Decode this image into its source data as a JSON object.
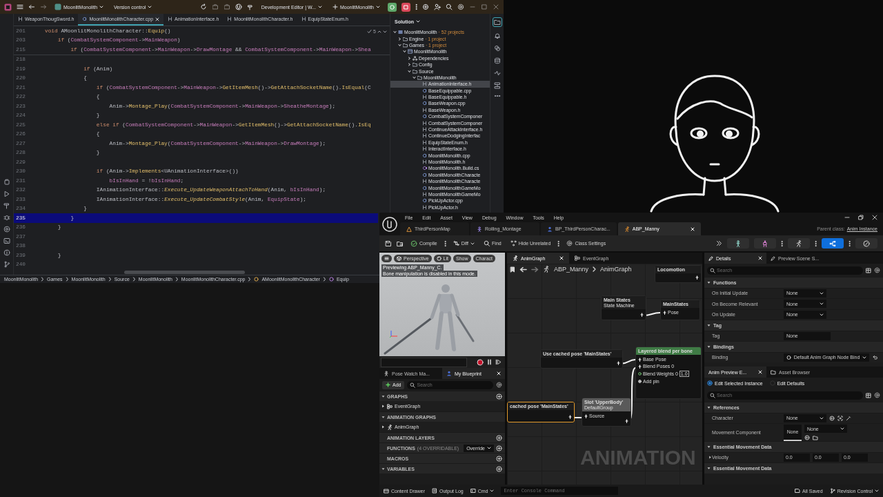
{
  "ide": {
    "title_bar": {
      "project": "MoonlitMonolith",
      "vcs": "Version control",
      "run_config": "Development Editor | W...",
      "target": "MoonlitMonolith"
    },
    "tabs": [
      {
        "label": "WeaponThougSword.h",
        "kind": "h",
        "selected": false
      },
      {
        "label": "MoonlitMonolithCharacter.cpp",
        "kind": "cpp",
        "selected": true
      },
      {
        "label": "AnimationInterface.h",
        "kind": "h",
        "selected": false
      },
      {
        "label": "MoonlitMonolithCharacter.h",
        "kind": "h",
        "selected": false
      },
      {
        "label": "EquipStateEnum.h",
        "kind": "h",
        "selected": false
      }
    ],
    "inspection_count": "5",
    "sticky_lines": [
      {
        "number": "201",
        "tokens": [
          {
            "text": "void",
            "kind": "keyword"
          },
          {
            "text": " AMoonlitMonolithCharacter::",
            "kind": "plain"
          },
          {
            "text": "Equip",
            "kind": "method"
          },
          {
            "text": "()",
            "kind": "plain"
          }
        ]
      },
      {
        "number": "203",
        "tokens": [
          {
            "text": "    if",
            "kind": "keyword"
          },
          {
            "text": " (",
            "kind": "plain"
          },
          {
            "text": "CombatSystemComponent",
            "kind": "field"
          },
          {
            "text": "->",
            "kind": "plain"
          },
          {
            "text": "MainWeapon",
            "kind": "field"
          },
          {
            "text": ")",
            "kind": "plain"
          }
        ]
      },
      {
        "number": "215",
        "tokens": [
          {
            "text": "        if",
            "kind": "keyword"
          },
          {
            "text": " (",
            "kind": "plain"
          },
          {
            "text": "CombatSystemComponent",
            "kind": "field"
          },
          {
            "text": "->",
            "kind": "plain"
          },
          {
            "text": "MainWeapon",
            "kind": "field"
          },
          {
            "text": "->",
            "kind": "plain"
          },
          {
            "text": "DrawMontage",
            "kind": "field"
          },
          {
            "text": " && ",
            "kind": "plain"
          },
          {
            "text": "CombatSystemComponent",
            "kind": "field"
          },
          {
            "text": "->",
            "kind": "plain"
          },
          {
            "text": "MainWeapon",
            "kind": "field"
          },
          {
            "text": "->",
            "kind": "plain"
          },
          {
            "text": "Shea",
            "kind": "field"
          }
        ]
      }
    ],
    "lines": [
      {
        "number": "218",
        "current": false
      },
      {
        "number": "219",
        "current": false,
        "tokens": [
          {
            "text": "            if",
            "kind": "keyword"
          },
          {
            "text": " (Anim)",
            "kind": "plain"
          }
        ]
      },
      {
        "number": "220",
        "current": false,
        "tokens": [
          {
            "text": "            {",
            "kind": "plain"
          }
        ]
      },
      {
        "number": "221",
        "current": false,
        "tokens": [
          {
            "text": "                if",
            "kind": "keyword"
          },
          {
            "text": " (",
            "kind": "plain"
          },
          {
            "text": "CombatSystemComponent",
            "kind": "field"
          },
          {
            "text": "->",
            "kind": "plain"
          },
          {
            "text": "MainWeapon",
            "kind": "field"
          },
          {
            "text": "->",
            "kind": "plain"
          },
          {
            "text": "GetItemMesh",
            "kind": "method"
          },
          {
            "text": "()->",
            "kind": "plain"
          },
          {
            "text": "GetAttachSocketName",
            "kind": "method"
          },
          {
            "text": "().",
            "kind": "plain"
          },
          {
            "text": "IsEqual",
            "kind": "method"
          },
          {
            "text": "(C",
            "kind": "plain"
          }
        ]
      },
      {
        "number": "222",
        "current": false,
        "tokens": [
          {
            "text": "                {",
            "kind": "plain"
          }
        ]
      },
      {
        "number": "223",
        "current": false,
        "tokens": [
          {
            "text": "                    Anim->",
            "kind": "plain"
          },
          {
            "text": "Montage_Play",
            "kind": "method"
          },
          {
            "text": "(",
            "kind": "plain"
          },
          {
            "text": "CombatSystemComponent",
            "kind": "field"
          },
          {
            "text": "->",
            "kind": "plain"
          },
          {
            "text": "MainWeapon",
            "kind": "field"
          },
          {
            "text": "->",
            "kind": "plain"
          },
          {
            "text": "SheatheMontage",
            "kind": "field"
          },
          {
            "text": ");",
            "kind": "plain"
          }
        ]
      },
      {
        "number": "224",
        "current": false,
        "tokens": [
          {
            "text": "                }",
            "kind": "plain"
          }
        ]
      },
      {
        "number": "225",
        "current": false,
        "tokens": [
          {
            "text": "                else if",
            "kind": "keyword"
          },
          {
            "text": " (",
            "kind": "plain"
          },
          {
            "text": "CombatSystemComponent",
            "kind": "field"
          },
          {
            "text": "->",
            "kind": "plain"
          },
          {
            "text": "MainWeapon",
            "kind": "field"
          },
          {
            "text": "->",
            "kind": "plain"
          },
          {
            "text": "GetItemMesh",
            "kind": "method"
          },
          {
            "text": "()->",
            "kind": "plain"
          },
          {
            "text": "GetAttachSocketName",
            "kind": "method"
          },
          {
            "text": "().",
            "kind": "plain"
          },
          {
            "text": "IsEq",
            "kind": "method"
          }
        ]
      },
      {
        "number": "226",
        "current": false,
        "tokens": [
          {
            "text": "                {",
            "kind": "plain"
          }
        ]
      },
      {
        "number": "227",
        "current": false,
        "tokens": [
          {
            "text": "                    Anim->",
            "kind": "plain"
          },
          {
            "text": "Montage_Play",
            "kind": "method"
          },
          {
            "text": "(",
            "kind": "plain"
          },
          {
            "text": "CombatSystemComponent",
            "kind": "field"
          },
          {
            "text": "->",
            "kind": "plain"
          },
          {
            "text": "MainWeapon",
            "kind": "field"
          },
          {
            "text": "->",
            "kind": "plain"
          },
          {
            "text": "DrawMontage",
            "kind": "field"
          },
          {
            "text": ");",
            "kind": "plain"
          }
        ]
      },
      {
        "number": "228",
        "current": false,
        "tokens": [
          {
            "text": "                }",
            "kind": "plain"
          }
        ]
      },
      {
        "number": "229",
        "current": false
      },
      {
        "number": "230",
        "current": false,
        "tokens": [
          {
            "text": "                if",
            "kind": "keyword"
          },
          {
            "text": " (Anim->",
            "kind": "plain"
          },
          {
            "text": "Implements",
            "kind": "method"
          },
          {
            "text": "<UAnimationInterface>())",
            "kind": "plain"
          }
        ]
      },
      {
        "number": "231",
        "current": false,
        "tokens": [
          {
            "text": "                    bIsInHand",
            "kind": "field"
          },
          {
            "text": " = !",
            "kind": "plain"
          },
          {
            "text": "bIsInHand",
            "kind": "field"
          },
          {
            "text": ";",
            "kind": "plain"
          }
        ]
      },
      {
        "number": "232",
        "current": false,
        "tokens": [
          {
            "text": "                IAnimationInterface::",
            "kind": "plain"
          },
          {
            "text": "Execute_UpdateWeaponAttachToHand",
            "kind": "static-method"
          },
          {
            "text": "(Anim, ",
            "kind": "plain"
          },
          {
            "text": "bIsInHand",
            "kind": "field"
          },
          {
            "text": ");",
            "kind": "plain"
          }
        ]
      },
      {
        "number": "233",
        "current": false,
        "tokens": [
          {
            "text": "                IAnimationInterface::",
            "kind": "plain"
          },
          {
            "text": "Execute_UpdateCombatStyle",
            "kind": "static-method"
          },
          {
            "text": "(Anim, ",
            "kind": "plain"
          },
          {
            "text": "EquipState",
            "kind": "field"
          },
          {
            "text": ");",
            "kind": "plain"
          }
        ]
      },
      {
        "number": "234",
        "current": false,
        "tokens": [
          {
            "text": "            }",
            "kind": "plain"
          }
        ]
      },
      {
        "number": "235",
        "current": true,
        "tokens": [
          {
            "text": "        }",
            "kind": "plain"
          }
        ]
      },
      {
        "number": "236",
        "current": false,
        "tokens": [
          {
            "text": "    }",
            "kind": "plain"
          }
        ]
      },
      {
        "number": "237",
        "current": false
      },
      {
        "number": "238",
        "current": false
      },
      {
        "number": "239",
        "current": false,
        "tokens": [
          {
            "text": "    }",
            "kind": "plain"
          }
        ]
      },
      {
        "number": "240",
        "current": false
      }
    ],
    "breadcrumb": [
      {
        "label": "MoonlitMonolith",
        "kind": "folder"
      },
      {
        "label": "Games",
        "kind": "folder"
      },
      {
        "label": "MoonlitMonolith",
        "kind": "folder"
      },
      {
        "label": "Source",
        "kind": "folder"
      },
      {
        "label": "MoonlitMonolith",
        "kind": "folder"
      },
      {
        "label": "MoonlitMonolithCharacter.cpp",
        "kind": "file"
      },
      {
        "label": "AMoonlitMonolithCharacter",
        "kind": "class"
      },
      {
        "label": "Equip",
        "kind": "method"
      }
    ],
    "solution": {
      "title": "Solution",
      "tree": [
        {
          "label": "MoonlitMonolith",
          "note": "· 52 projects",
          "kind": "solution",
          "expanded": true,
          "selected": false,
          "children": [
            {
              "label": "Engine",
              "note": "· 1 project",
              "kind": "folder",
              "expanded": false,
              "selected": false
            },
            {
              "label": "Games",
              "note": "· 1 project",
              "kind": "folder",
              "expanded": true,
              "selected": false,
              "children": [
                {
                  "label": "MoonlitMonolith",
                  "kind": "project",
                  "expanded": true,
                  "selected": false,
                  "children": [
                    {
                      "label": "Dependencies",
                      "kind": "dependencies",
                      "expanded": false,
                      "selected": false
                    },
                    {
                      "label": "Config",
                      "kind": "folder",
                      "expanded": false,
                      "selected": false
                    },
                    {
                      "label": "Source",
                      "kind": "folder",
                      "expanded": true,
                      "selected": false,
                      "children": [
                        {
                          "label": "MoonlitMonolith",
                          "kind": "folder",
                          "expanded": true,
                          "selected": false,
                          "children": [
                            {
                              "label": "AnimationInterface.h",
                              "kind": "h",
                              "selected": true
                            },
                            {
                              "label": "BaseEquippable.cpp",
                              "kind": "cpp",
                              "selected": false
                            },
                            {
                              "label": "BaseEquippable.h",
                              "kind": "h",
                              "selected": false
                            },
                            {
                              "label": "BaseWeapon.cpp",
                              "kind": "cpp",
                              "selected": false
                            },
                            {
                              "label": "BaseWeapon.h",
                              "kind": "h",
                              "selected": false
                            },
                            {
                              "label": "CombatSystemComponer",
                              "kind": "cpp",
                              "selected": false
                            },
                            {
                              "label": "CombatSystemComponer",
                              "kind": "h",
                              "selected": false
                            },
                            {
                              "label": "ContinueAttackInterface.h",
                              "kind": "h",
                              "selected": false
                            },
                            {
                              "label": "ContinueDodgingInterfac",
                              "kind": "h",
                              "selected": false
                            },
                            {
                              "label": "EquipStateEnum.h",
                              "kind": "h",
                              "selected": false
                            },
                            {
                              "label": "InteractInterface.h",
                              "kind": "h",
                              "selected": false
                            },
                            {
                              "label": "MoonlitMonolith.cpp",
                              "kind": "cpp",
                              "selected": false
                            },
                            {
                              "label": "MoonlitMonolith.h",
                              "kind": "h",
                              "selected": false
                            },
                            {
                              "label": "MoonlitMonolith.Build.cs",
                              "kind": "cs",
                              "selected": false
                            },
                            {
                              "label": "MoonlitMonolithCharacte",
                              "kind": "cpp",
                              "selected": false
                            },
                            {
                              "label": "MoonlitMonolithCharacte",
                              "kind": "h",
                              "selected": false
                            },
                            {
                              "label": "MoonlitMonolithGameMo",
                              "kind": "cpp",
                              "selected": false
                            },
                            {
                              "label": "MoonlitMonolithGameMo",
                              "kind": "h",
                              "selected": false
                            },
                            {
                              "label": "PickUpActor.cpp",
                              "kind": "cpp",
                              "selected": false
                            },
                            {
                              "label": "PickUpActor.h",
                              "kind": "h",
                              "selected": false
                            }
                          ]
                        }
                      ]
                    }
                  ]
                }
              ]
            }
          ]
        }
      ]
    }
  },
  "editor": {
    "menu": [
      "File",
      "Edit",
      "Asset",
      "View",
      "Debug",
      "Window",
      "Tools",
      "Help"
    ],
    "tabs": [
      {
        "label": "ThirdPersonMap",
        "kind": "level",
        "selected": false
      },
      {
        "label": "Rolling_Montage",
        "kind": "montage",
        "selected": false
      },
      {
        "label": "BP_ThirdPersonCharac...",
        "kind": "blueprint",
        "selected": false
      },
      {
        "label": "ABP_Manny",
        "kind": "anim-blueprint",
        "selected": true
      }
    ],
    "parent_class": {
      "label": "Parent class:",
      "value": "Anim Instance"
    },
    "toolbar": {
      "compile": "Compile",
      "diff": "Diff",
      "find": "Find",
      "hide_unrelated": "Hide Unrelated",
      "class_settings": "Class Settings",
      "modes": [
        {
          "kind": "skeleton",
          "selected": false
        },
        {
          "kind": "mesh",
          "selected": false
        },
        {
          "kind": "animation",
          "selected": false
        },
        {
          "kind": "graph",
          "selected": true
        }
      ]
    },
    "viewport": {
      "chips": [
        {
          "label": "Perspective",
          "kind": "view"
        },
        {
          "label": "Lit",
          "kind": "lighting"
        },
        {
          "label": "Show",
          "kind": "show"
        },
        {
          "label": "Charact",
          "kind": "character"
        }
      ],
      "notices": [
        "Previewing ABP_Manny_C.",
        "Bone manipulation is disabled in this mode."
      ]
    },
    "left_tabs": [
      {
        "label": "Pose Watch Ma...",
        "kind": "pose-watch",
        "selected": false
      },
      {
        "label": "My Blueprint",
        "kind": "blueprint",
        "selected": true
      }
    ],
    "my_blueprint": {
      "add": "Add",
      "search_placeholder": "Search",
      "sections": [
        {
          "label": "GRAPHS",
          "expanded": true,
          "addable": true,
          "items": [
            {
              "label": "EventGraph",
              "kind": "event-graph"
            }
          ]
        },
        {
          "label": "ANIMATION GRAPHS",
          "expanded": true,
          "addable": false,
          "items": [
            {
              "label": "AnimGraph",
              "kind": "anim-graph"
            }
          ]
        },
        {
          "label": "ANIMATION LAYERS",
          "addable": true
        },
        {
          "label": "FUNCTIONS",
          "note": "(4 OVERRIDABLE)",
          "action": "Override",
          "addable": true
        },
        {
          "label": "MACROS",
          "addable": true
        },
        {
          "label": "VARIABLES",
          "expanded": true,
          "addable": true
        }
      ]
    },
    "graph": {
      "tabs": [
        {
          "label": "AnimGraph",
          "kind": "anim-graph",
          "selected": true
        },
        {
          "label": "EventGraph",
          "kind": "event-graph",
          "selected": false
        }
      ],
      "breadcrumb": [
        "ABP_Manny",
        "AnimGraph"
      ],
      "nodes": [
        {
          "kind": "state-machine-ref",
          "title": "Locomotion",
          "selected": false
        },
        {
          "kind": "state-machine",
          "title": "Main States",
          "subtitle": "State Machine",
          "selected": false
        },
        {
          "kind": "cache",
          "title": "MainStates",
          "pins": [
            {
              "label": "Pose",
              "kind": "pose"
            }
          ],
          "selected": false
        },
        {
          "kind": "cached-pose",
          "title": "Use cached pose 'MainStates'",
          "selected": false
        },
        {
          "kind": "blend",
          "title": "Layered blend per bone",
          "pins": [
            {
              "label": "Base Pose",
              "kind": "pose"
            },
            {
              "label": "Blend Poses 0",
              "kind": "pose"
            },
            {
              "label": "Blend Weights 0",
              "kind": "float",
              "value": "1.0"
            }
          ],
          "add_pin": "Add pin",
          "selected": false
        },
        {
          "kind": "cached-pose",
          "title": "cached pose 'MainStates'",
          "selected": true
        },
        {
          "kind": "slot",
          "title": "Slot 'UpperBody'",
          "subtitle": "DefaultGroup",
          "pins": [
            {
              "label": "Source",
              "kind": "pose"
            }
          ],
          "selected": false
        }
      ],
      "overlay_label": "ANIMATION"
    },
    "details": {
      "tabs": [
        {
          "label": "Details",
          "selected": true
        },
        {
          "label": "Preview Scene S...",
          "selected": false
        }
      ],
      "search_placeholder": "Search",
      "sections": [
        {
          "label": "Functions",
          "expanded": true,
          "rows": [
            {
              "label": "On Initial Update",
              "kind": "dropdown",
              "value": "None"
            },
            {
              "label": "On Become Relevant",
              "kind": "dropdown",
              "value": "None"
            },
            {
              "label": "On Update",
              "kind": "dropdown",
              "value": "None"
            }
          ]
        },
        {
          "label": "Tag",
          "expanded": true,
          "rows": [
            {
              "label": "Tag",
              "kind": "text",
              "value": "None"
            }
          ]
        },
        {
          "label": "Bindings",
          "expanded": true,
          "rows": [
            {
              "label": "Binding",
              "kind": "binding",
              "value": "Default Anim Graph Node Bind"
            }
          ]
        }
      ]
    },
    "preview": {
      "tabs": [
        {
          "label": "Anim Preview E...",
          "selected": true
        },
        {
          "label": "Asset Browser",
          "selected": false
        }
      ],
      "modes": [
        {
          "label": "Edit Selected Instance",
          "selected": true
        },
        {
          "label": "Edit Defaults",
          "selected": false
        }
      ],
      "search_placeholder": "Search",
      "sections": [
        {
          "label": "References",
          "expanded": true,
          "rows": [
            {
              "label": "Character",
              "kind": "asset",
              "value": "None"
            },
            {
              "label": "Movement Component",
              "kind": "asset-thumb",
              "thumb": "None",
              "value": "None"
            }
          ]
        },
        {
          "label": "Essential Movement Data",
          "expanded": true,
          "rows": [
            {
              "label": "Velocity",
              "kind": "vector",
              "expanded": false,
              "values": [
                "0.0",
                "0.0",
                "0.0"
              ]
            }
          ]
        },
        {
          "label": "Essential Movement Data",
          "expanded": true
        }
      ]
    },
    "status_bar": {
      "buttons": [
        {
          "label": "Content Drawer",
          "kind": "drawer"
        },
        {
          "label": "Output Log",
          "kind": "log"
        },
        {
          "label": "Cmd",
          "kind": "cmd"
        }
      ],
      "console_placeholder": "Enter Console Command",
      "save_state": "All Saved",
      "revision": "Revision Control"
    }
  }
}
